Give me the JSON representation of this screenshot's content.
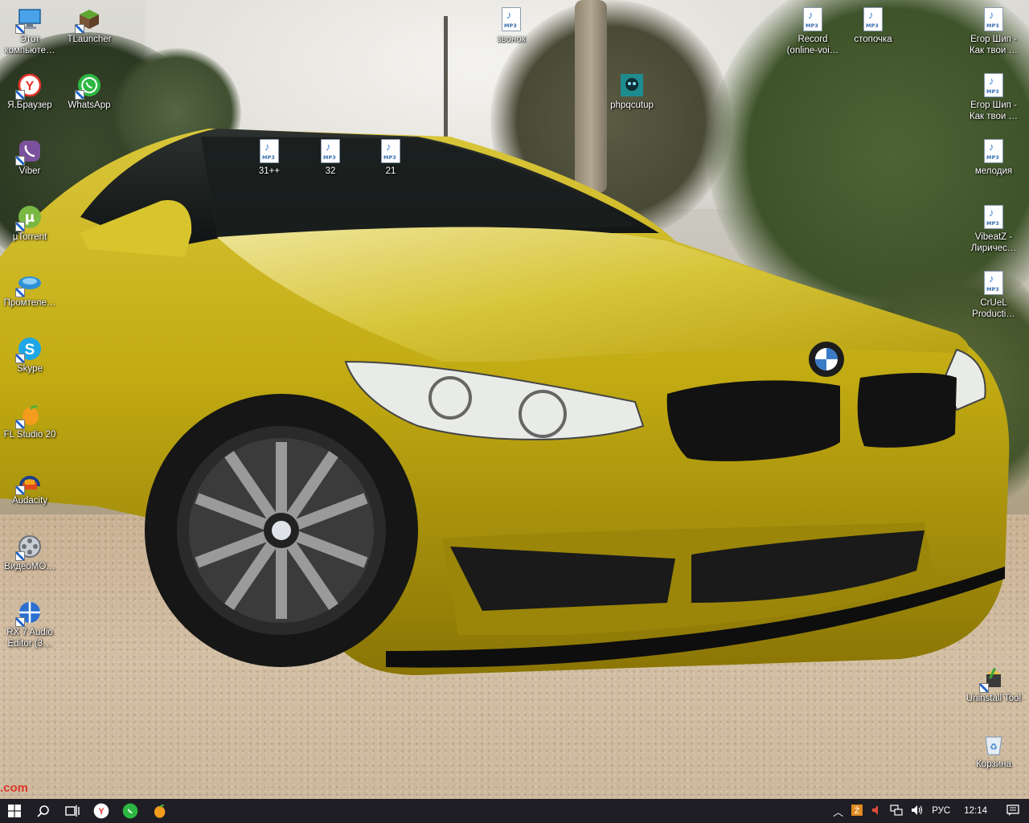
{
  "desktop": {
    "icons_left": [
      {
        "name": "this-pc",
        "label": "Этот компьюте…",
        "icon": "computer-icon"
      },
      {
        "name": "tlauncher",
        "label": "TLauncher",
        "icon": "minecraft-block-icon"
      },
      {
        "name": "yandex-browser",
        "label": "Я.Браузер",
        "icon": "yandex-browser-icon"
      },
      {
        "name": "whatsapp",
        "label": "WhatsApp",
        "icon": "whatsapp-icon"
      },
      {
        "name": "viber",
        "label": "Viber",
        "icon": "viber-icon"
      },
      {
        "name": "utorrent",
        "label": "µTorrent",
        "icon": "utorrent-icon"
      },
      {
        "name": "promtelecom",
        "label": "Промтеле…",
        "icon": "promtelecom-icon"
      },
      {
        "name": "skype",
        "label": "Skype",
        "icon": "skype-icon"
      },
      {
        "name": "fl-studio",
        "label": "FL Studio 20",
        "icon": "fl-studio-icon"
      },
      {
        "name": "audacity",
        "label": "Audacity",
        "icon": "audacity-icon"
      },
      {
        "name": "videomontage",
        "label": "ВидеоМО…",
        "icon": "film-reel-icon"
      },
      {
        "name": "rx-audio-editor",
        "label": "RX 7 Audio Editor (3…",
        "icon": "rx-audio-icon"
      }
    ],
    "icons_mid": [
      {
        "name": "file-31",
        "label": "31++"
      },
      {
        "name": "file-32",
        "label": "32"
      },
      {
        "name": "file-21",
        "label": "21"
      },
      {
        "name": "file-zvonok",
        "label": "звонок"
      },
      {
        "name": "phpqcutup",
        "label": "phpqcutup"
      }
    ],
    "icons_right": [
      {
        "name": "file-record",
        "label": "Record (online-voi…"
      },
      {
        "name": "file-stopochka",
        "label": "стопочка"
      },
      {
        "name": "file-egor-1",
        "label": "Егор Шип - Как твои …"
      },
      {
        "name": "file-egor-2",
        "label": "Егор Шип - Как твои …"
      },
      {
        "name": "file-melodiya",
        "label": "мелодия"
      },
      {
        "name": "file-vibeatz",
        "label": "VibeatZ - Лиричес…"
      },
      {
        "name": "file-cruel",
        "label": "CrUeL Producti…"
      },
      {
        "name": "uninstall-tool",
        "label": "Uninstall Tool"
      },
      {
        "name": "recycle-bin",
        "label": "Корзина"
      }
    ],
    "mp3_tag": "MP3",
    "watermark": ".com"
  },
  "taskbar": {
    "pinned": [
      "start-icon",
      "search-icon",
      "task-view-icon",
      "yandex-browser-icon",
      "whatsapp-icon",
      "fl-studio-icon"
    ],
    "tray": {
      "language": "РУС",
      "time": "12:14"
    }
  },
  "colors": {
    "taskbar_bg": "#1f1e24",
    "car_yellow": "#c9b31a"
  }
}
